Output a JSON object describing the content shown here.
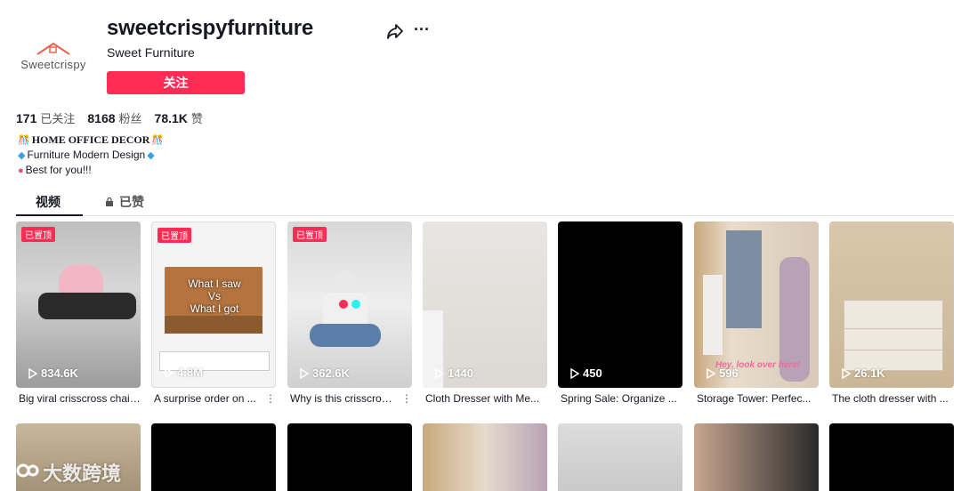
{
  "profile": {
    "avatar_text": "Sweetcrispy",
    "username": "sweetcrispyfurniture",
    "nickname": "Sweet Furniture",
    "follow_label": "关注"
  },
  "stats": [
    {
      "value": "171",
      "label": "已关注"
    },
    {
      "value": "8168",
      "label": "粉丝"
    },
    {
      "value": "78.1K",
      "label": "赞"
    }
  ],
  "bio": {
    "line1": "HOME OFFICE DECOR",
    "line2": "Furniture Modern Design",
    "line3": "Best for you!!!"
  },
  "tabs": {
    "videos": "视频",
    "liked": "已赞"
  },
  "pinned_label": "已置顶",
  "videos": [
    {
      "views": "834.6K",
      "caption": "Big viral crisscross chair...",
      "pinned": true
    },
    {
      "views": "4.8M",
      "caption": "A surprise order on ...",
      "pinned": true
    },
    {
      "views": "362.6K",
      "caption": "Why is this crisscros...",
      "pinned": true
    },
    {
      "views": "1440",
      "caption": "Cloth Dresser with Me...",
      "pinned": false
    },
    {
      "views": "450",
      "caption": "Spring Sale: Organize ...",
      "pinned": false
    },
    {
      "views": "596",
      "caption": "Storage Tower: Perfec...",
      "pinned": false
    },
    {
      "views": "26.1K",
      "caption": "The cloth dresser with ...",
      "pinned": false
    }
  ],
  "video_overlay_texts": {
    "v2_line1": "What I saw",
    "v2_line2": "Vs",
    "v2_line3": "What I got",
    "v6_overlay": "Hey, look over here!"
  },
  "watermark": "大数跨境",
  "colors": {
    "accent": "#fe2c55",
    "text": "#161823"
  }
}
